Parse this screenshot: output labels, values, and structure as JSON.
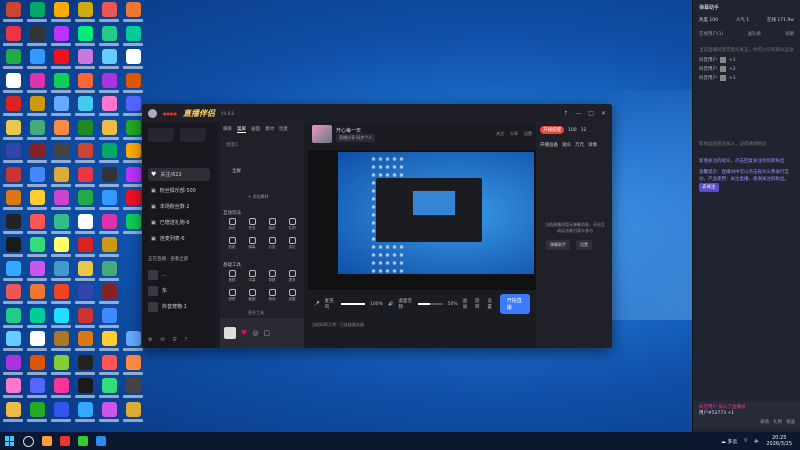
{
  "desktop": {
    "icon_colors": [
      "#c43",
      "#e34",
      "#2a4",
      "#fff",
      "#d22",
      "#e7c84a",
      "#34a",
      "#c33",
      "#d71",
      "#222",
      "#1a1a1a",
      "#3af",
      "#e55",
      "#2c8",
      "#6cf",
      "#a3d",
      "#f7c",
      "#eb4",
      "#0a6",
      "#333",
      "#39f",
      "#d3a",
      "#c91",
      "#4a7",
      "#822",
      "#48f",
      "#fc3",
      "#f55",
      "#3d7",
      "#c5e",
      "#e73",
      "#0c9",
      "#fff",
      "#d50",
      "#56f",
      "#2a2",
      "#fa0",
      "#b3f",
      "#e12",
      "#1c5",
      "#6af",
      "#f84",
      "#444",
      "#da3",
      "#c4c",
      "#3b8",
      "#ff6",
      "#49c",
      "#e42",
      "#2df",
      "#a72",
      "#8c3",
      "#f39",
      "#35e",
      "#ca1",
      "#0e7",
      "#c7d",
      "#f63",
      "#4ce",
      "#282"
    ]
  },
  "app": {
    "logo": "直播伴侣",
    "version": "V9.8.8",
    "user_tag": "●●●●",
    "window_controls": [
      "↑",
      "—",
      "□",
      "✕"
    ],
    "sidebar": {
      "items": [
        {
          "label": "关注/622",
          "icon": "heart-icon",
          "active": true
        },
        {
          "label": "粉丝俱乐部·500",
          "icon": "fan-club-icon",
          "active": false
        },
        {
          "label": "本场粉丝数·2",
          "icon": "fans-icon",
          "active": false
        },
        {
          "label": "已赠送礼物·6",
          "icon": "gift-icon",
          "active": false
        },
        {
          "label": "连麦列表·6",
          "icon": "link-icon",
          "active": false
        }
      ],
      "section_title": "正在直播",
      "section_more": "查看全部",
      "rooms": [
        {
          "label": "..."
        },
        {
          "label": "东"
        },
        {
          "label": "抖音宠物·1"
        }
      ]
    },
    "scene": {
      "tabs": [
        "横屏",
        "竖屏"
      ],
      "sub_tabs": [
        "画面",
        "素材",
        "连麦"
      ],
      "scene_label": "场景1",
      "source_label": "全屏",
      "add_source": "+ 添加素材",
      "interactive_title": "互动玩法",
      "tools_title": "基础工具",
      "interactive_tools": [
        "玩法",
        "任务",
        "抽奖",
        "礼物",
        "贴纸",
        "弹幕",
        "公告",
        "评论"
      ],
      "basic_tools": [
        "美颜",
        "字幕",
        "录屏",
        "更多",
        "滤镜",
        "截图",
        "音效",
        "设置"
      ],
      "more_tools": "更多工具"
    },
    "preview": {
      "room_title": "开心每一天",
      "tag": "直播分享·同步个人",
      "actions": [
        "关注",
        "分享",
        "设置"
      ],
      "volume_left_label": "麦克风",
      "volume_left_value": "100%",
      "volume_left_level": 1.0,
      "volume_right_label": "桌面音频",
      "volume_right_value": "50%",
      "volume_right_level": 0.5,
      "extra_controls": [
        "画质",
        "旋转",
        "设置"
      ],
      "start_button": "开始直播",
      "status": "当前码率正常 · 已连接服务器"
    },
    "right_panel": {
      "tabs": [
        "开播准备",
        "观众",
        "万元",
        "详情"
      ],
      "live_pill": "开播提醒",
      "counts": [
        "100",
        "12",
        "1万+"
      ],
      "message": "当前直播间暂无弹幕消息，开启互动玩法吸引观众参与",
      "buttons": [
        "弹幕助手",
        "设置"
      ]
    }
  },
  "notification_panel": {
    "title": "弹幕助手",
    "stats": [
      "热度 100",
      "人气 1",
      "在线 171.9w"
    ],
    "tabs": [
      "在线用户(1)",
      "送礼榜",
      "贡献"
    ],
    "hint": "当前直播间暂无观众发言，你可以引导观众互动",
    "lines": [
      {
        "label": "抖音用户",
        "value": "+1"
      },
      {
        "label": "抖音用户",
        "value": "+2"
      },
      {
        "label": "抖音用户",
        "value": "+1"
      }
    ],
    "gray_notice": "新粉丝团成员加入，记得感谢粉丝",
    "purple_notice": "新增关注的观众，点击回复关注你的新粉丝",
    "purple_detail": "温馨提示：直播间中可以点击观众头像进行互动，产品使用：关注直播，感谢关注的粉丝。",
    "follow_button": "去关注",
    "bottom_title": "抖音用户 加入了直播间",
    "bottom_user": "用户#52773 +1",
    "bottom_tools": [
      "表情",
      "礼物",
      "发送"
    ]
  },
  "taskbar": {
    "apps": [
      "#ff9b3d",
      "#e33",
      "#3c3",
      "#2d8cf0"
    ],
    "weather": "☁ 多云",
    "time": "20:25",
    "date": "2026/3/25"
  }
}
